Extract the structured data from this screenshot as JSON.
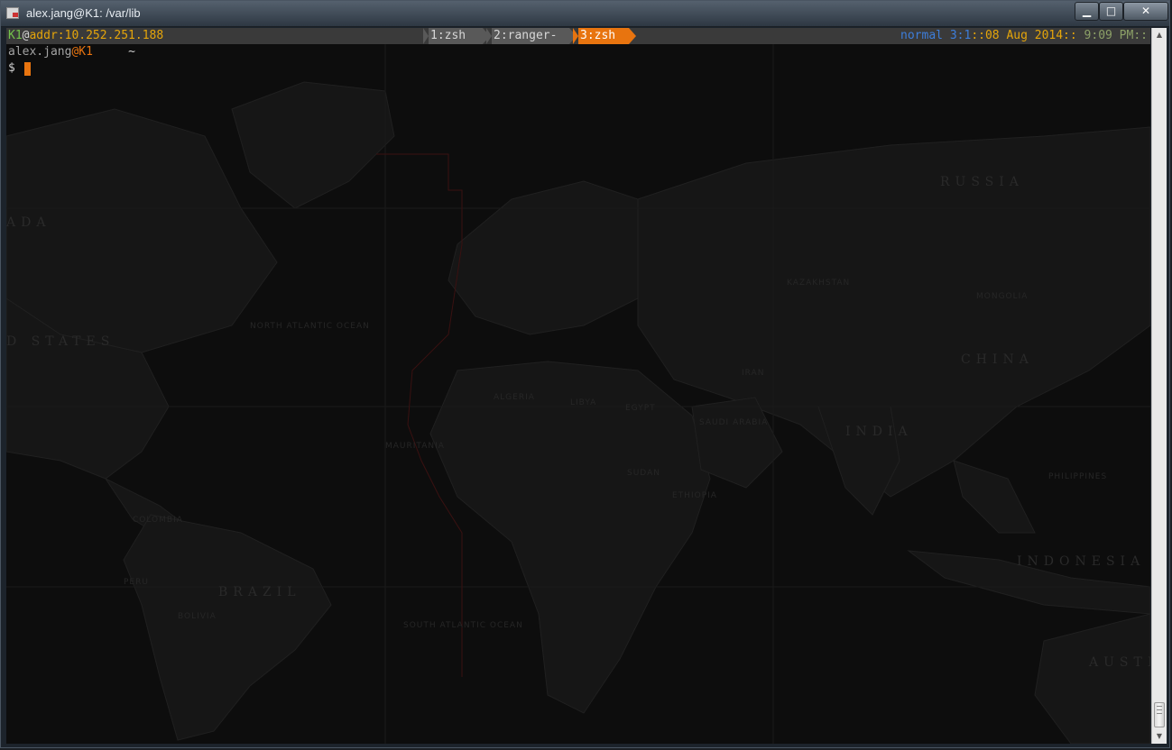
{
  "window": {
    "title": "alex.jang@K1: /var/lib",
    "controls": {
      "minimize": "▁",
      "maximize": "□",
      "close": "✕"
    }
  },
  "statusbar": {
    "host": "K1",
    "at": "@",
    "addr": "addr:10.252.251.188",
    "tabs": [
      {
        "label": "1:zsh",
        "active": false
      },
      {
        "label": "2:ranger-",
        "active": false
      },
      {
        "label": "3:zsh",
        "active": true
      }
    ],
    "mode": "normal",
    "position": "3:1",
    "date": "::08 Aug 2014::",
    "time": " 9:09 PM::"
  },
  "prompt": {
    "user": "alex.jang",
    "at": "@",
    "host": "K1",
    "dir": "~",
    "symbol": "$"
  },
  "map_labels": {
    "russia": "RUSSIA",
    "canada": "ADA",
    "united_states": "D STATES",
    "china": "CHINA",
    "india": "INDIA",
    "brazil": "BRAZIL",
    "indonesia": "INDONESIA",
    "mongolia": "MONGOLIA",
    "kazakhstan": "KAZAKHSTAN",
    "iran": "IRAN",
    "saudi_arabia": "SAUDI ARABIA",
    "egypt": "EGYPT",
    "libya": "LIBYA",
    "sudan": "SUDAN",
    "ethiopia": "ETHIOPIA",
    "australia": "AUSTRA",
    "north_atlantic": "NORTH ATLANTIC OCEAN",
    "south_atlantic": "SOUTH ATLANTIC OCEAN",
    "philippines": "PHILIPPINES",
    "colombia": "COLOMBIA",
    "peru": "PERU",
    "bolivia": "BOLIVIA",
    "algeria": "ALGERIA",
    "mauritania": "MAURITANIA"
  }
}
